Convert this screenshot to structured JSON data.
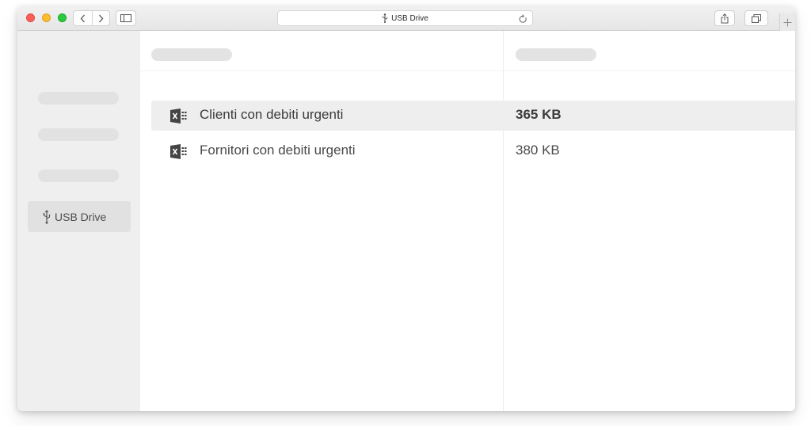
{
  "browser": {
    "address": "USB Drive",
    "icons": {
      "back": "chevron-left-icon",
      "forward": "chevron-right-icon",
      "sidebar": "sidebar-icon",
      "reload": "reload-icon",
      "share": "share-icon",
      "tabs": "tabs-icon",
      "new_tab": "plus-icon",
      "location": "usb-icon"
    }
  },
  "sidebar": {
    "selected_item": {
      "label": "USB Drive",
      "icon": "usb-icon"
    }
  },
  "files": [
    {
      "name": "Clienti con debiti urgenti",
      "size": "365 KB",
      "icon": "excel-file-icon",
      "selected": true
    },
    {
      "name": "Fornitori con debiti urgenti",
      "size": "380 KB",
      "icon": "excel-file-icon",
      "selected": false
    }
  ],
  "colors": {
    "close": "#fc5f57",
    "minimize": "#fdbc2e",
    "maximize": "#29c940",
    "sidebar_bg": "#efefef",
    "selected_row": "#eeeeee",
    "placeholder": "#e2e2e2"
  }
}
